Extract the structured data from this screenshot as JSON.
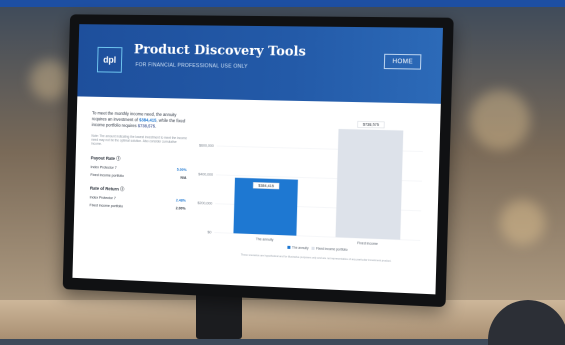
{
  "app": {
    "logo_text": "dpl",
    "title": "Product Discovery Tools",
    "subtitle": "FOR FINANCIAL PROFESSIONAL USE ONLY",
    "home_label": "HOME"
  },
  "summary": {
    "text_a": "To meet the monthly income need, the annuity requires an investment of",
    "annuity_amount": "$384,415",
    "text_b": ", while the fixed income portfolio requires",
    "fixed_amount": "$738,575",
    "text_c": ".",
    "note": "Note: The amount indicating the lowest investment to meet the income need may not be the optimal solution. Also consider cumulative income."
  },
  "payout_rate": {
    "heading": "Payout Rate ⓘ",
    "rows": [
      {
        "label": "Index Protector 7",
        "value": "5.00%"
      },
      {
        "label": "Fixed income portfolio",
        "value": "N/A"
      }
    ]
  },
  "rate_of_return": {
    "heading": "Rate of Return ⓘ",
    "rows": [
      {
        "label": "Index Protector 7",
        "value": "2.48%"
      },
      {
        "label": "Fixed income portfolio",
        "value": "2.00%"
      }
    ]
  },
  "chart_data": {
    "type": "bar",
    "categories": [
      "The annuity",
      "Fixed income"
    ],
    "values": [
      384415,
      738575
    ],
    "value_labels": [
      "$384,415",
      "$738,575"
    ],
    "colors": [
      "#1e78d2",
      "#dde2ea"
    ],
    "y_ticks": [
      {
        "value": 0,
        "label": "$0"
      },
      {
        "value": 200000,
        "label": "$200,000"
      },
      {
        "value": 400000,
        "label": "$400,000"
      },
      {
        "value": 600000,
        "label": "$600,000"
      }
    ],
    "ylim": [
      0,
      800000
    ],
    "legend": [
      "The annuity",
      "Fixed income portfolio"
    ],
    "legend_placement": "bottom",
    "footnote": "These scenarios are hypothetical and for illustrative purposes only and are not representative of any particular investment product."
  },
  "colors": {
    "accent": "#1e78d2",
    "banner": "#235aa8"
  }
}
